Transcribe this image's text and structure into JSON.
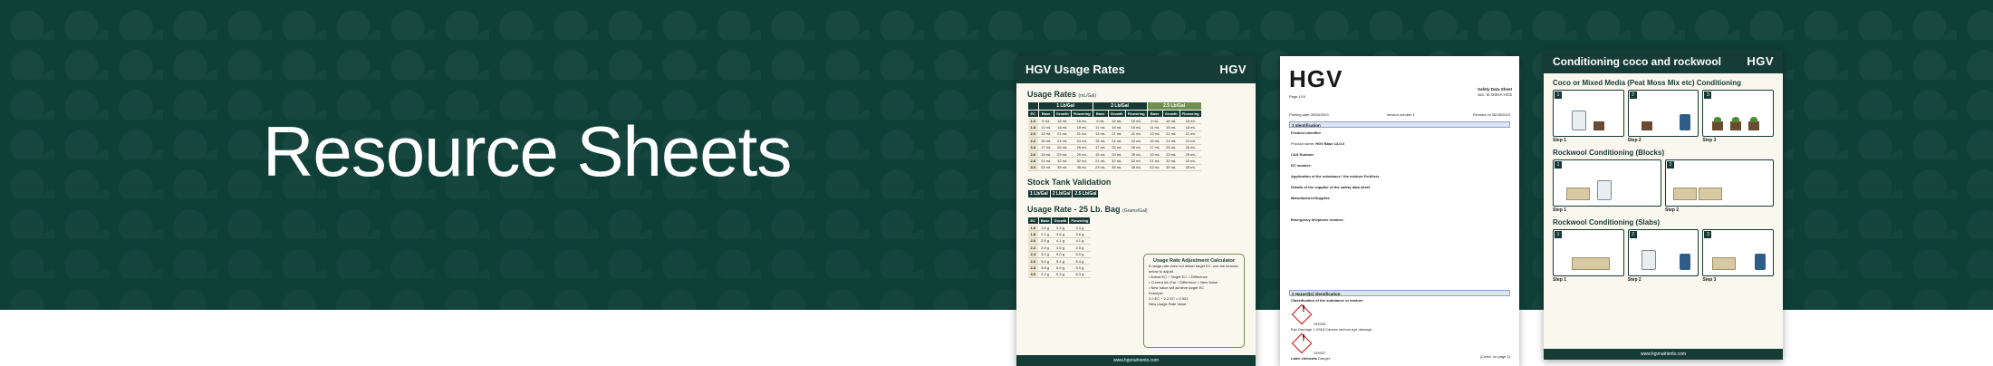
{
  "hero": {
    "title": "Resource Sheets"
  },
  "usage_sheet": {
    "title": "HGV Usage Rates",
    "logo": "HGV",
    "section1_title": "Usage Rates",
    "section1_unit": "(mL/Gal)",
    "groups": [
      "1 Lb/Gal",
      "2 Lb/Gal",
      "2.5 Lb/Gal"
    ],
    "cols": [
      "EC",
      "Base",
      "Growth",
      "Flowering"
    ],
    "rows": [
      [
        "1.6",
        "9 mL",
        "16 mL",
        "16 mL"
      ],
      [
        "1.8",
        "11 mL",
        "18 mL",
        "18 mL"
      ],
      [
        "2.0",
        "13 mL",
        "21 mL",
        "21 mL"
      ],
      [
        "2.2",
        "15 mL",
        "24 mL",
        "24 mL"
      ],
      [
        "2.4",
        "17 mL",
        "26 mL",
        "26 mL"
      ],
      [
        "2.6",
        "19 mL",
        "29 mL",
        "29 mL"
      ],
      [
        "2.8",
        "21 mL",
        "32 mL",
        "32 mL"
      ],
      [
        "3.0",
        "23 mL",
        "35 mL",
        "35 mL"
      ]
    ],
    "section2_title": "Stock Tank Validation",
    "section3_title": "Usage Rate - 25 Lb. Bag",
    "section3_unit": "(Grams/Gal)",
    "bag_cols": [
      "EC",
      "Base",
      "Growth",
      "Flowering"
    ],
    "bag_rows": [
      [
        "1.6",
        "1.8 g",
        "3.3 g",
        "3.3 g"
      ],
      [
        "1.8",
        "2.1 g",
        "3.6 g",
        "3.6 g"
      ],
      [
        "2.0",
        "2.5 g",
        "4.1 g",
        "4.1 g"
      ],
      [
        "2.2",
        "2.8 g",
        "4.5 g",
        "4.5 g"
      ],
      [
        "2.4",
        "3.2 g",
        "5.0 g",
        "5.0 g"
      ],
      [
        "2.6",
        "3.5 g",
        "5.4 g",
        "5.4 g"
      ],
      [
        "2.8",
        "3.8 g",
        "5.9 g",
        "5.9 g"
      ],
      [
        "3.0",
        "4.2 g",
        "6.3 g",
        "6.3 g"
      ]
    ],
    "calc_title": "Usage Rate Adjustment Calculator",
    "calc_lines": [
      "If usage rate does not obtain target EC, use the formula below to adjust.",
      "• Actual EC ÷ Target EC = Difference",
      "• Current mL/Gal ÷ Difference = New Value",
      "• New Value will achieve target EC",
      "Example:",
      "2.0 EC ÷ 2.2 EC = 0.903",
      "New Usage Rate Value:"
    ],
    "footer": "www.hgvnutrients.com"
  },
  "sds_sheet": {
    "logo": "HGV",
    "right_title": "Safety Data Sheet",
    "right_sub": "acc. to OSHA HCS",
    "page": "Page 1/10",
    "printing_date": "Printing date 05/28/2023",
    "version": "Version number 1",
    "revised": "Revised on 05/28/2023",
    "section1": "1 Identification",
    "product_identifier": "Product identifier",
    "product_name_label": "Product name:",
    "product_name": "HGV Base 14-0-0",
    "cas_label": "CAS Number:",
    "ec_label": "EC number:",
    "application_label": "Application of the substance / the mixture Fertilizer",
    "supplier_label": "Details of the supplier of the safety data sheet",
    "manufacturer_label": "Manufacturer/Supplier:",
    "emergency_label": "Emergency telephone number:",
    "section2": "2 Hazard(s) identification",
    "classification": "Classification of the substance or mixture",
    "ghs05": "GHS05",
    "ghs07": "GHS07",
    "eye_damage": "Eye Damage 1     H318 Causes serious eye damage.",
    "label_elements": "Label elements",
    "signal_word": "Danger",
    "footer": "(Contd. on page 2)"
  },
  "conditioning_sheet": {
    "title": "Conditioning coco and rockwool",
    "logo": "HGV",
    "sec1": "Coco or Mixed Media (Peat Moss Mix etc) Conditioning",
    "sec2": "Rockwool Conditioning (Blocks)",
    "sec3": "Rockwool Conditioning (Slabs)",
    "step1": "Step 1",
    "step2": "Step 2",
    "step3": "Step 3",
    "step_n1": "1",
    "step_n2": "2",
    "step_n3": "3",
    "footer": "www.hgvnutrients.com"
  },
  "colors": {
    "band": "#0f4038",
    "accent": "#6e8f52",
    "sheet_header": "#153d36"
  }
}
